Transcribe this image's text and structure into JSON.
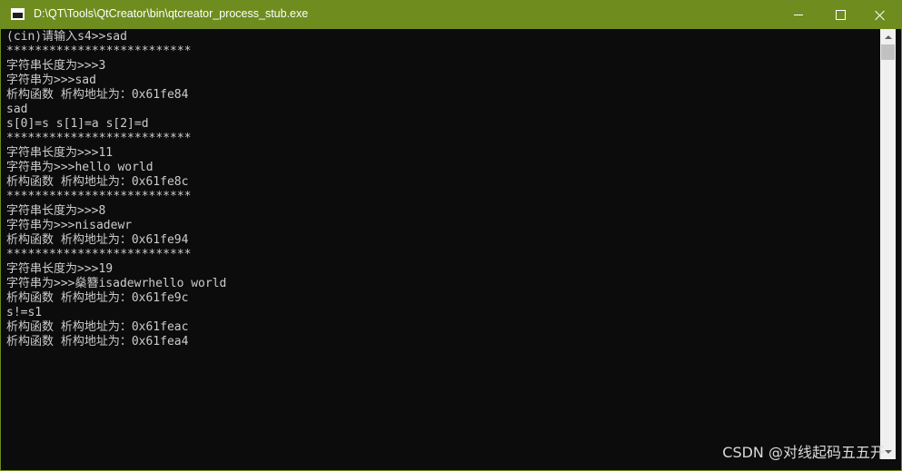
{
  "window": {
    "title": "D:\\QT\\Tools\\QtCreator\\bin\\qtcreator_process_stub.exe"
  },
  "console": {
    "lines": [
      "(cin)请输入s4>>sad",
      "**************************",
      "字符串长度为>>>3",
      "字符串为>>>sad",
      "析构函数 析构地址为：0x61fe84",
      "sad",
      "s[0]=s s[1]=a s[2]=d",
      "**************************",
      "字符串长度为>>>11",
      "字符串为>>>hello world",
      "析构函数 析构地址为：0x61fe8c",
      "**************************",
      "字符串长度为>>>8",
      "字符串为>>>nisadewr",
      "析构函数 析构地址为：0x61fe94",
      "**************************",
      "字符串长度为>>>19",
      "字符串为>>>燊簪isadewrhello world",
      "析构函数 析构地址为：0x61fe9c",
      "s!=s1",
      "析构函数 析构地址为：0x61feac",
      "析构函数 析构地址为：0x61fea4"
    ]
  },
  "watermark": {
    "text": "CSDN @对线起码五五开"
  },
  "colors": {
    "titlebar": "#6f8d1f",
    "console_bg": "#0c0c0c",
    "console_fg": "#cccccc"
  }
}
